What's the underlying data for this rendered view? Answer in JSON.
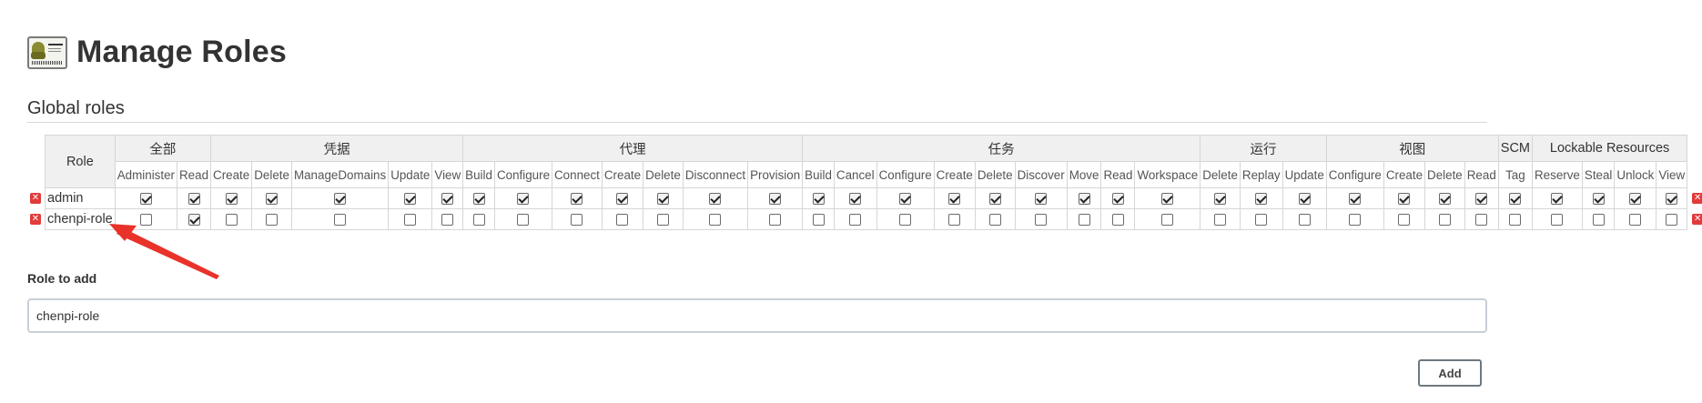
{
  "page": {
    "title": "Manage Roles"
  },
  "global": {
    "section_title": "Global roles",
    "role_header": "Role",
    "groups": [
      {
        "name": "全部",
        "span": 2
      },
      {
        "name": "凭据",
        "span": 5
      },
      {
        "name": "代理",
        "span": 7
      },
      {
        "name": "任务",
        "span": 9
      },
      {
        "name": "运行",
        "span": 3
      },
      {
        "name": "视图",
        "span": 4
      },
      {
        "name": "SCM",
        "span": 1
      },
      {
        "name": "Lockable Resources",
        "span": 4
      }
    ],
    "permissions": [
      "Administer",
      "Read",
      "Create",
      "Delete",
      "ManageDomains",
      "Update",
      "View",
      "Build",
      "Configure",
      "Connect",
      "Create",
      "Delete",
      "Disconnect",
      "Provision",
      "Build",
      "Cancel",
      "Configure",
      "Create",
      "Delete",
      "Discover",
      "Move",
      "Read",
      "Workspace",
      "Delete",
      "Replay",
      "Update",
      "Configure",
      "Create",
      "Delete",
      "Read",
      "Tag",
      "Reserve",
      "Steal",
      "Unlock",
      "View"
    ],
    "roles": [
      {
        "name": "admin",
        "checked": [
          1,
          1,
          1,
          1,
          1,
          1,
          1,
          1,
          1,
          1,
          1,
          1,
          1,
          1,
          1,
          1,
          1,
          1,
          1,
          1,
          1,
          1,
          1,
          1,
          1,
          1,
          1,
          1,
          1,
          1,
          1,
          1,
          1,
          1,
          1
        ]
      },
      {
        "name": "chenpi-role",
        "checked": [
          0,
          1,
          0,
          0,
          0,
          0,
          0,
          0,
          0,
          0,
          0,
          0,
          0,
          0,
          0,
          0,
          0,
          0,
          0,
          0,
          0,
          0,
          0,
          0,
          0,
          0,
          0,
          0,
          0,
          0,
          0,
          0,
          0,
          0,
          0
        ]
      }
    ]
  },
  "add_role": {
    "label": "Role to add",
    "value": "chenpi-role",
    "button": "Add"
  },
  "colors": {
    "delete_icon": "#e23b3b",
    "annotation_arrow": "#e8322a"
  },
  "icons": {
    "delete": "delete-icon",
    "logo": "roles-logo-icon"
  }
}
